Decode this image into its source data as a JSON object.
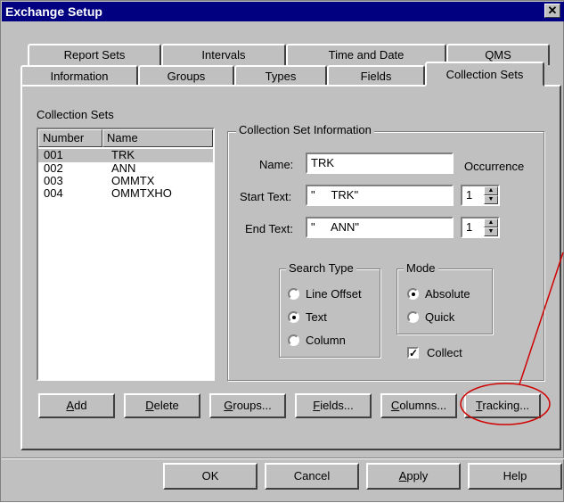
{
  "window": {
    "title": "Exchange Setup",
    "close_glyph": "✕"
  },
  "tabs_back": [
    "Report Sets",
    "Intervals",
    "Time and Date",
    "QMS"
  ],
  "tabs_front": [
    "Information",
    "Groups",
    "Types",
    "Fields",
    "Collection Sets"
  ],
  "collection_sets": {
    "label": "Collection Sets",
    "columns": [
      "Number",
      "Name"
    ],
    "rows": [
      {
        "number": "001",
        "name": "TRK"
      },
      {
        "number": "002",
        "name": "ANN"
      },
      {
        "number": "003",
        "name": "OMMTX"
      },
      {
        "number": "004",
        "name": "OMMTXHO"
      }
    ]
  },
  "info": {
    "title": "Collection Set Information",
    "name_label": "Name:",
    "name_value": "TRK",
    "occurrence_label": "Occurrence",
    "start_label": "Start Text:",
    "start_value": "\"     TRK\"",
    "start_occurrence": "1",
    "end_label": "End Text:",
    "end_value": "\"     ANN\"",
    "end_occurrence": "1"
  },
  "search_type": {
    "title": "Search Type",
    "options": [
      "Line Offset",
      "Text",
      "Column"
    ],
    "selected": "Text"
  },
  "mode": {
    "title": "Mode",
    "options": [
      "Absolute",
      "Quick"
    ],
    "selected": "Absolute"
  },
  "collect": {
    "label": "Collect",
    "checked": true,
    "glyph": "✓"
  },
  "action_buttons": {
    "add": {
      "u": "A",
      "rest": "dd"
    },
    "delete": {
      "u": "D",
      "rest": "elete"
    },
    "groups": {
      "u": "G",
      "rest": "roups..."
    },
    "fields": {
      "u": "F",
      "rest": "ields..."
    },
    "columns": {
      "u": "C",
      "rest": "olumns..."
    },
    "tracking": {
      "u": "T",
      "rest": "racking..."
    }
  },
  "dialog_buttons": {
    "ok": "OK",
    "cancel": "Cancel",
    "apply": {
      "u": "A",
      "rest": "pply"
    },
    "help": "Help"
  },
  "annotation_color": "#d00000"
}
